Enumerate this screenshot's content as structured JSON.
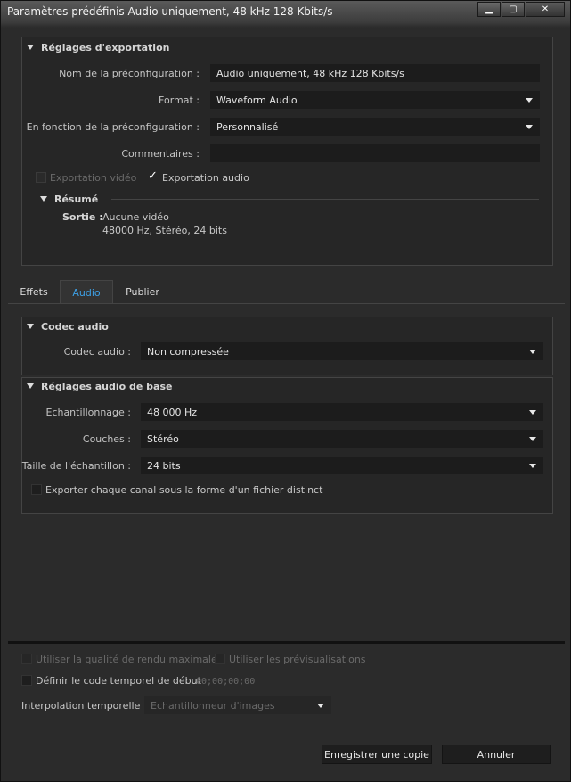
{
  "window": {
    "title": "Paramètres prédéfinis Audio uniquement, 48 kHz 128 Kbits/s",
    "minimize_icon": "minimize-icon",
    "maximize_icon": "maximize-icon",
    "close_icon": "close-icon"
  },
  "export_settings": {
    "title": "Réglages d'exportation",
    "preset_name_label": "Nom de la préconfiguration :",
    "preset_name_value": "Audio uniquement, 48 kHz 128 Kbits/s",
    "format_label": "Format :",
    "format_value": "Waveform Audio",
    "based_on_label": "En fonction de la préconfiguration :",
    "based_on_value": "Personnalisé",
    "comments_label": "Commentaires :",
    "comments_value": "",
    "export_video_label": "Exportation vidéo",
    "export_video_checked": false,
    "export_audio_label": "Exportation audio",
    "export_audio_checked": true,
    "summary_title": "Résumé",
    "output_key": "Sortie :",
    "output_line1": "Aucune vidéo",
    "output_line2": "48000  Hz, Stéréo, 24 bits"
  },
  "tabs": [
    {
      "label": "Effets",
      "active": false
    },
    {
      "label": "Audio",
      "active": true
    },
    {
      "label": "Publier",
      "active": false
    }
  ],
  "audio_codec": {
    "title": "Codec audio",
    "codec_label": "Codec audio :",
    "codec_value": "Non compressée"
  },
  "basic_audio": {
    "title": "Réglages audio de base",
    "sample_rate_label": "Echantillonnage :",
    "sample_rate_value": "48 000 Hz",
    "channels_label": "Couches :",
    "channels_value": "Stéréo",
    "sample_size_label": "Taille de l'échantillon :",
    "sample_size_value": "24 bits",
    "separate_files_label": "Exporter chaque canal sous la forme d'un fichier distinct"
  },
  "bottom": {
    "max_render_label": "Utiliser la qualité de rendu maximale",
    "use_previews_label": "Utiliser les prévisualisations",
    "start_timecode_label": "Définir le code temporel de début",
    "start_timecode_value": "00;00;00;00",
    "interp_label": "Interpolation temporelle :",
    "interp_value": "Echantillonneur d'images",
    "save_copy_label": "Enregistrer une copie",
    "cancel_label": "Annuler"
  },
  "colors": {
    "accent": "#3da0e6",
    "background": "#2b2b2b",
    "field": "#1c1c1c"
  }
}
